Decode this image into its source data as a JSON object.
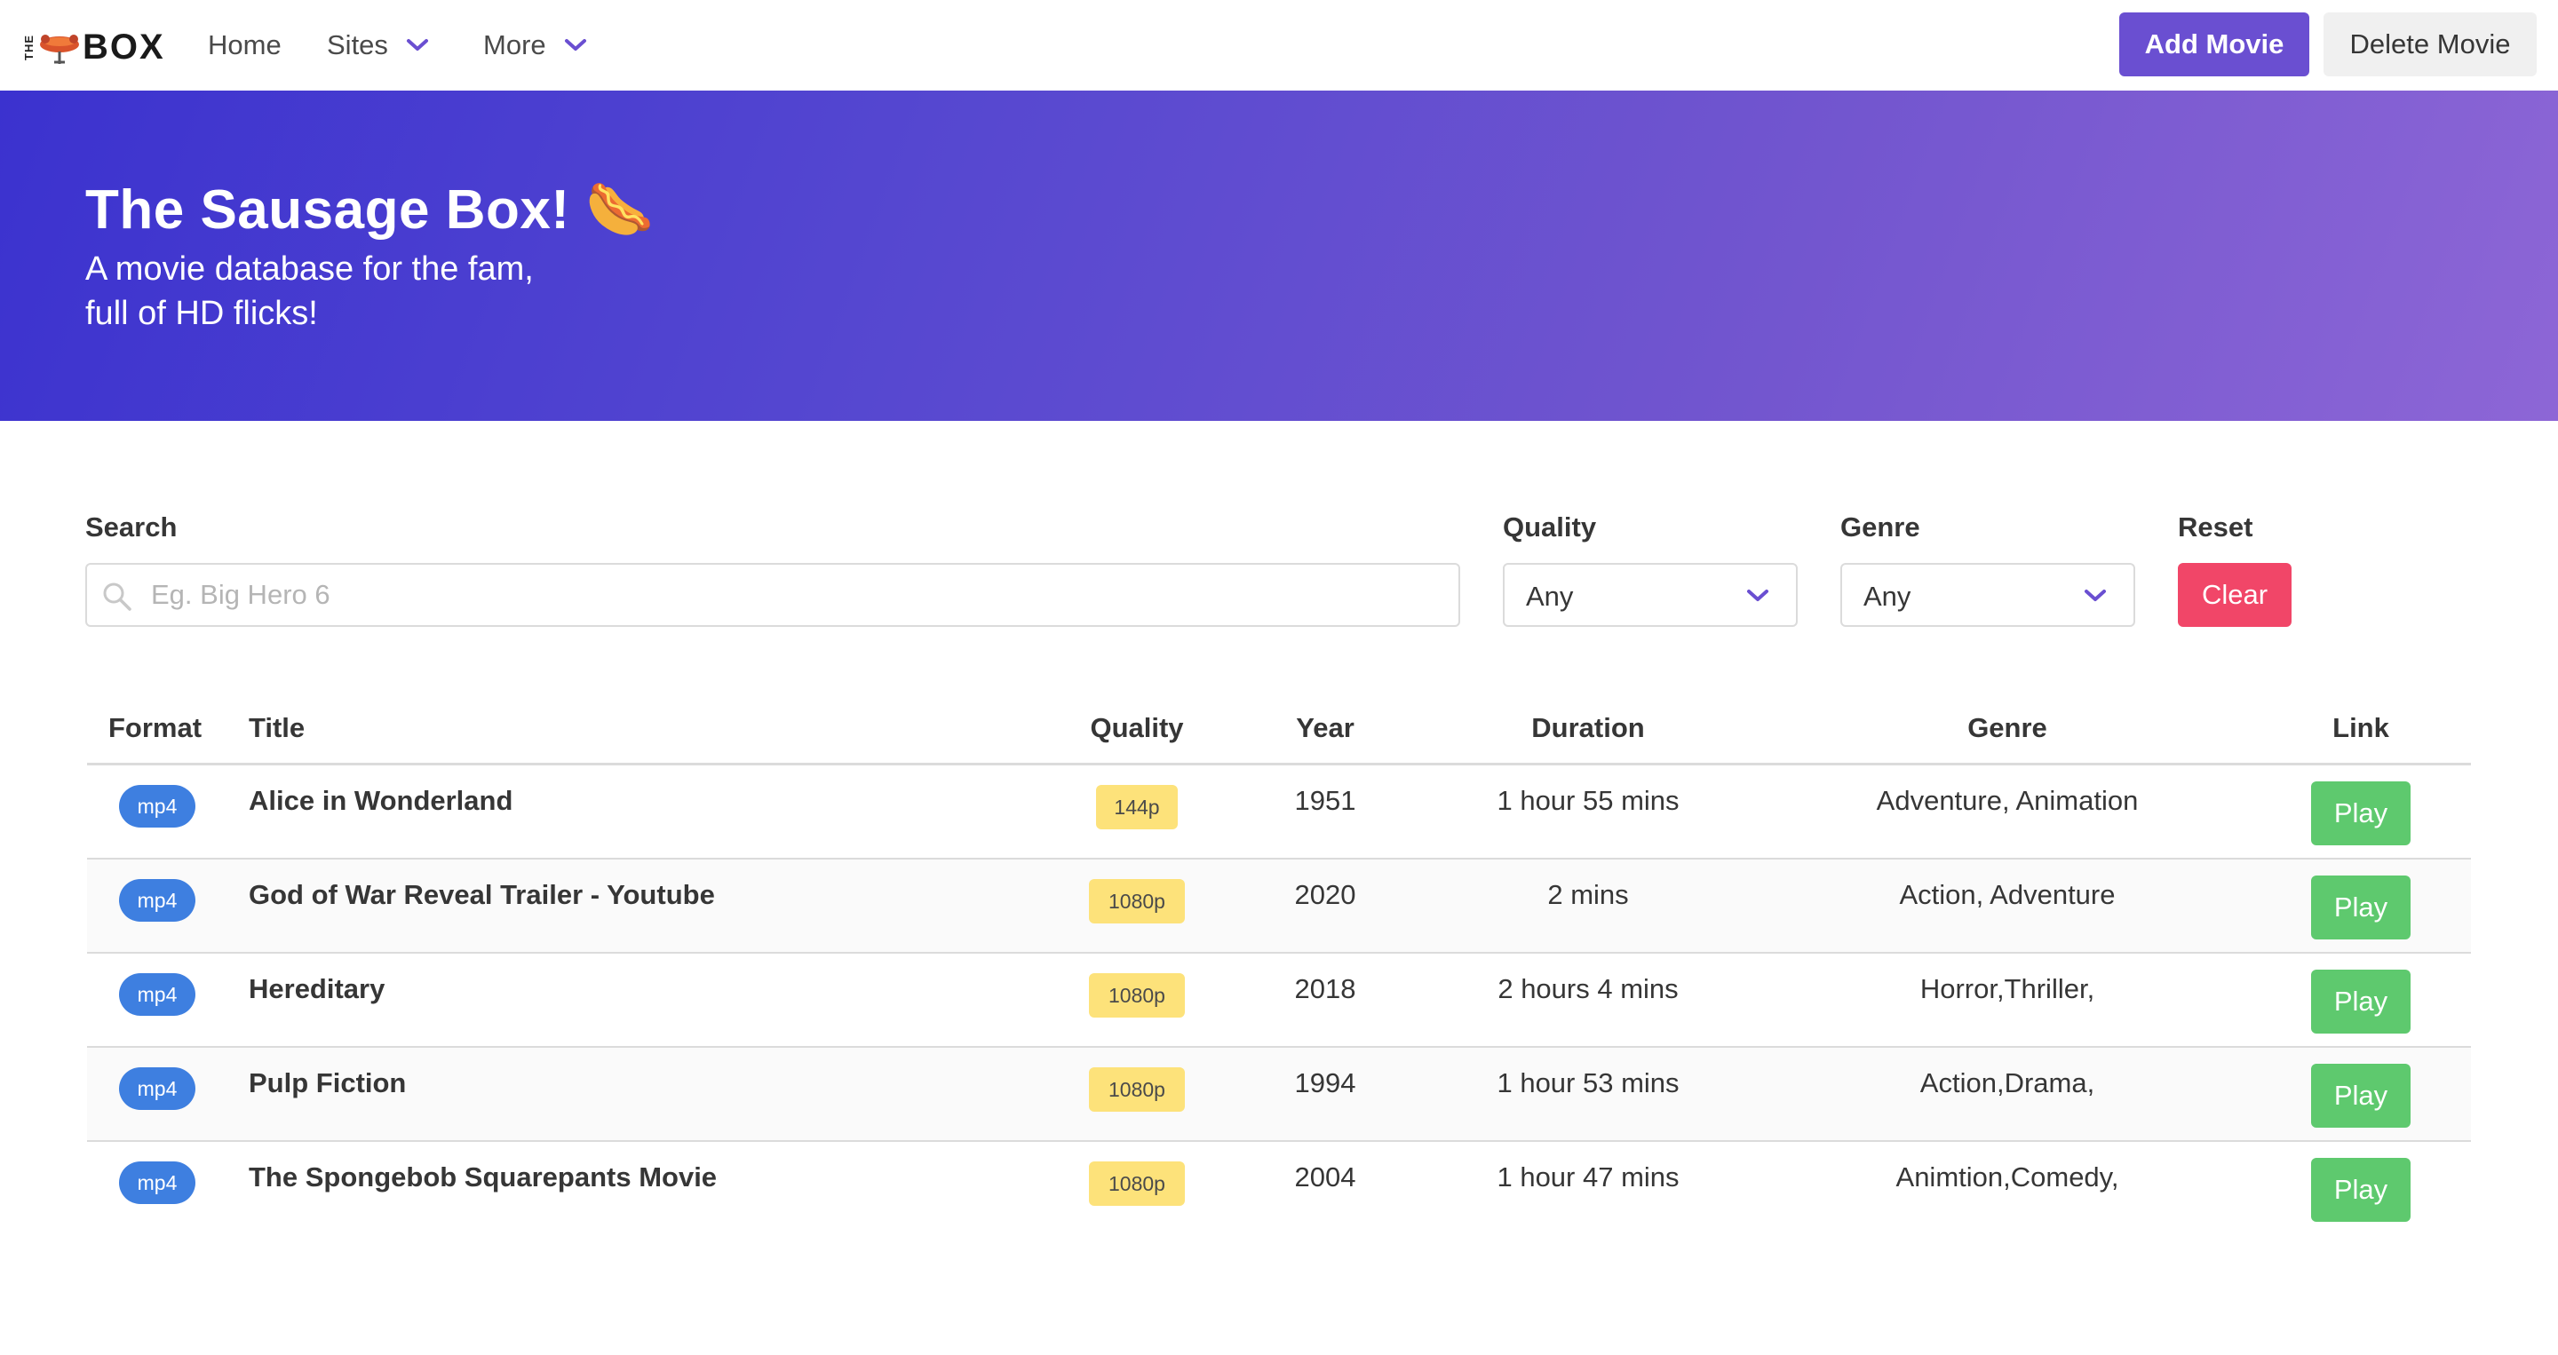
{
  "navbar": {
    "brand": {
      "the": "THE",
      "box": "BOX"
    },
    "items": [
      {
        "label": "Home"
      },
      {
        "label": "Sites",
        "dropdown": true
      },
      {
        "label": "More",
        "dropdown": true
      }
    ],
    "add_movie": "Add Movie",
    "delete_movie": "Delete Movie",
    "accent_color": "#6a4fd1"
  },
  "hero": {
    "title": "The Sausage Box! 🌭",
    "subtitle_line1": "A movie database for the fam,",
    "subtitle_line2": "full of HD flicks!"
  },
  "filters": {
    "search_label": "Search",
    "search_placeholder": "Eg. Big Hero 6",
    "search_value": "",
    "quality_label": "Quality",
    "quality_value": "Any",
    "genre_label": "Genre",
    "genre_value": "Any",
    "reset_label": "Reset",
    "clear_button": "Clear"
  },
  "table": {
    "headers": [
      "Format",
      "Title",
      "Quality",
      "Year",
      "Duration",
      "Genre",
      "Link"
    ],
    "rows": [
      {
        "format": "mp4",
        "title": "Alice in Wonderland",
        "quality": "144p",
        "year": "1951",
        "duration": "1 hour 55 mins",
        "genre": "Adventure, Animation",
        "link": "Play"
      },
      {
        "format": "mp4",
        "title": "God of War Reveal Trailer - Youtube",
        "quality": "1080p",
        "year": "2020",
        "duration": "2 mins",
        "genre": "Action, Adventure",
        "link": "Play"
      },
      {
        "format": "mp4",
        "title": "Hereditary",
        "quality": "1080p",
        "year": "2018",
        "duration": "2 hours 4 mins",
        "genre": "Horror,Thriller,",
        "link": "Play"
      },
      {
        "format": "mp4",
        "title": "Pulp Fiction",
        "quality": "1080p",
        "year": "1994",
        "duration": "1 hour 53 mins",
        "genre": "Action,Drama,",
        "link": "Play"
      },
      {
        "format": "mp4",
        "title": "The Spongebob Squarepants Movie",
        "quality": "1080p",
        "year": "2004",
        "duration": "1 hour 47 mins",
        "genre": "Animtion,Comedy,",
        "link": "Play"
      }
    ]
  },
  "colors": {
    "format_tag": "#3e7fe0",
    "quality_tag": "#fde27a",
    "play_button": "#5ec96e",
    "clear_button": "#f14668"
  }
}
